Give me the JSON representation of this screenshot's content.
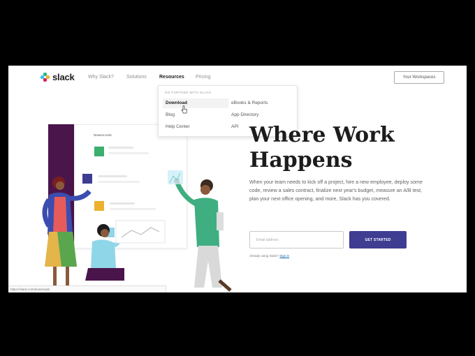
{
  "nav": {
    "logo_text": "slack",
    "links": [
      "Why Slack?",
      "Solutions",
      "Resources",
      "Pricing"
    ],
    "workspace_button": "Your Workspaces"
  },
  "dropdown": {
    "heading": "GO FURTHER WITH SLACK",
    "items": [
      "Download",
      "eBooks & Reports",
      "Blog",
      "App Directory",
      "Help Center",
      "API"
    ]
  },
  "illustration": {
    "card_title": "Newest tools"
  },
  "hero": {
    "title_line1": "Where Work",
    "title_line2": "Happens",
    "body": "When your team needs to kick off a project, hire a new employee, deploy some code, review a sales contract, finalize next year's budget, measure an A/B test, plan your next office opening, and more, Slack has you covered.",
    "email_placeholder": "Email address",
    "cta_label": "GET STARTED",
    "signin_prefix": "Already using Slack?",
    "signin_link": "Sign in"
  },
  "status_bar": {
    "text": "https://slack.com/downloads"
  },
  "colors": {
    "aubergine": "#4a154b",
    "cta": "#3e3d92",
    "green": "#2eb67d",
    "blue": "#36c5f0",
    "yellow": "#ecb22e",
    "red": "#e01e5a"
  }
}
